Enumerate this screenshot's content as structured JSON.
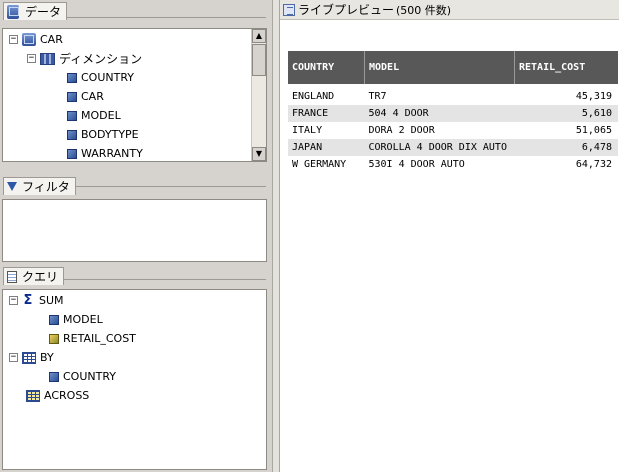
{
  "data_panel": {
    "title": "データ",
    "tree": {
      "root": "CAR",
      "dimension": "ディメンション",
      "fields": [
        "COUNTRY",
        "CAR",
        "MODEL",
        "BODYTYPE",
        "WARRANTY"
      ]
    },
    "expander_minus": "−"
  },
  "filter_panel": {
    "title": "フィルタ"
  },
  "query_panel": {
    "title": "クエリ",
    "sum_label": "SUM",
    "sum_fields": [
      "MODEL",
      "RETAIL_COST"
    ],
    "by_label": "BY",
    "by_fields": [
      "COUNTRY"
    ],
    "across_label": "ACROSS"
  },
  "preview": {
    "title": "ライブプレビュー",
    "count": "(500 件数)",
    "columns": [
      "COUNTRY",
      "MODEL",
      "RETAIL_COST"
    ],
    "rows": [
      [
        "ENGLAND",
        "TR7",
        "45,319"
      ],
      [
        "FRANCE",
        "504 4 DOOR",
        "5,610"
      ],
      [
        "ITALY",
        "DORA 2 DOOR",
        "51,065"
      ],
      [
        "JAPAN",
        "COROLLA 4 DOOR DIX AUTO",
        "6,478"
      ],
      [
        "W GERMANY",
        "530I 4 DOOR AUTO",
        "64,732"
      ]
    ]
  },
  "scroll_up": "▲",
  "scroll_down": "▼",
  "colors": {
    "panel_bg": "#d6d3ce",
    "header_bg": "#585858",
    "alt_row": "#e4e4e4"
  }
}
